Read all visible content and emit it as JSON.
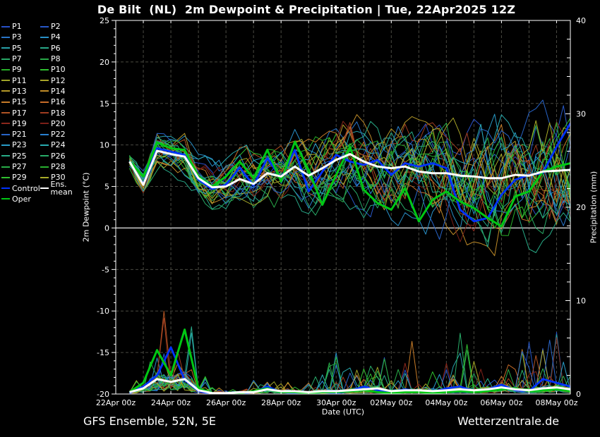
{
  "title": "De Bilt  (NL)  2m Dewpoint & Precipitation | Tue, 22Apr2025 12Z",
  "footer": {
    "left": "GFS Ensemble, 52N, 5E",
    "right": "Wetterzentrale.de"
  },
  "axes": {
    "left": {
      "title": "2m Dewpoint (°C)",
      "min": -20,
      "max": 25,
      "major_step": 5,
      "minor_step": 1,
      "tick_labels": [
        "25",
        "20",
        "15",
        "10",
        "5",
        "0",
        "-5",
        "-10",
        "-15",
        "-20"
      ]
    },
    "right": {
      "title": "Precipitation (mm)",
      "min": 0,
      "max": 40,
      "major_step": 10,
      "minor_step": 2,
      "tick_labels": [
        "40",
        "30",
        "20",
        "10",
        "0"
      ]
    },
    "bottom": {
      "title": "Date (UTC)",
      "hours_total": 396,
      "grid_every_hours": 24,
      "label_every_hours": 48,
      "tick_labels": [
        "22Apr 00z",
        "24Apr 00z",
        "26Apr 00z",
        "28Apr 00z",
        "30Apr 00z",
        "02May 00z",
        "04May 00z",
        "06May 00z",
        "08May 00z"
      ]
    }
  },
  "colors": {
    "background": "#000000",
    "grid": "#4a4a42",
    "axis": "#ffffff",
    "zero_line": "#ffffff"
  },
  "legend": {
    "members": [
      {
        "label": "P1",
        "color": "#2850c8"
      },
      {
        "label": "P2",
        "color": "#2858c8"
      },
      {
        "label": "P3",
        "color": "#2874c8"
      },
      {
        "label": "P4",
        "color": "#2890c8"
      },
      {
        "label": "P5",
        "color": "#28a0a8"
      },
      {
        "label": "P6",
        "color": "#28a888"
      },
      {
        "label": "P7",
        "color": "#28a868"
      },
      {
        "label": "P8",
        "color": "#28a848"
      },
      {
        "label": "P9",
        "color": "#28b028"
      },
      {
        "label": "P10",
        "color": "#30c030"
      },
      {
        "label": "P11",
        "color": "#a0a428"
      },
      {
        "label": "P12",
        "color": "#a8a428"
      },
      {
        "label": "P13",
        "color": "#b49828"
      },
      {
        "label": "P14",
        "color": "#c08c28"
      },
      {
        "label": "P15",
        "color": "#c87c28"
      },
      {
        "label": "P16",
        "color": "#c86c28"
      },
      {
        "label": "P17",
        "color": "#b05424"
      },
      {
        "label": "P18",
        "color": "#a03c20"
      },
      {
        "label": "P19",
        "color": "#8c281c"
      },
      {
        "label": "P20",
        "color": "#7c2018"
      },
      {
        "label": "P21",
        "color": "#2864c8"
      },
      {
        "label": "P22",
        "color": "#2880d0"
      },
      {
        "label": "P23",
        "color": "#289cc8"
      },
      {
        "label": "P24",
        "color": "#28acb0"
      },
      {
        "label": "P25",
        "color": "#28ac88"
      },
      {
        "label": "P26",
        "color": "#28ac68"
      },
      {
        "label": "P27",
        "color": "#28ac48"
      },
      {
        "label": "P28",
        "color": "#28b030"
      },
      {
        "label": "P29",
        "color": "#30c030"
      },
      {
        "label": "P30",
        "color": "#a8ac28"
      }
    ],
    "special": [
      {
        "label": "Control",
        "color": "#0032ff"
      },
      {
        "label": "Ens. mean",
        "color": "#ffffff"
      },
      {
        "label": "Oper",
        "color": "#00c814"
      }
    ]
  },
  "chart_data": {
    "type": "line",
    "title": "De Bilt  (NL)  2m Dewpoint & Precipitation | Tue, 22Apr2025 12Z",
    "xlabel": "Date (UTC)",
    "ylabel_left": "2m Dewpoint (°C)",
    "ylabel_right": "Precipitation (mm)",
    "ylim_left": [
      -20,
      25
    ],
    "ylim_right": [
      0,
      40
    ],
    "x_range_hours": [
      0,
      396
    ],
    "x_start_label": "22Apr 00z",
    "x_end_label": "08May 12z",
    "forecast_hours": {
      "start": 12,
      "end": 396,
      "step": 12
    },
    "grid": "dashed daily vertical, dashed every 5°C horizontal, solid white line at 0°C",
    "series": [
      {
        "name": "Ens. mean",
        "color": "#ffffff",
        "width": 3,
        "dewpoint": [
          8.0,
          5.2,
          9.3,
          8.9,
          8.6,
          6.0,
          4.9,
          5.0,
          5.9,
          5.3,
          6.6,
          6.2,
          7.4,
          6.3,
          7.2,
          8.2,
          8.9,
          8.0,
          7.4,
          7.2,
          7.4,
          6.8,
          6.6,
          6.6,
          6.3,
          6.2,
          6.0,
          6.0,
          6.4,
          6.3,
          6.8,
          6.9,
          7.0
        ],
        "precip": [
          0.2,
          0.6,
          1.6,
          1.3,
          1.6,
          0.4,
          0.1,
          0.1,
          0.2,
          0.2,
          0.5,
          0.3,
          0.3,
          0.2,
          0.3,
          0.3,
          0.4,
          0.5,
          0.6,
          0.3,
          0.4,
          0.4,
          0.3,
          0.4,
          0.5,
          0.4,
          0.5,
          0.7,
          0.5,
          0.4,
          0.6,
          0.7,
          0.5
        ]
      },
      {
        "name": "Control",
        "color": "#0032ff",
        "width": 2.8,
        "dewpoint": [
          8.0,
          5.3,
          9.6,
          9.2,
          8.8,
          5.8,
          4.7,
          5.2,
          7.3,
          5.1,
          8.4,
          6.0,
          9.4,
          4.4,
          6.8,
          8.8,
          8.0,
          7.6,
          8.2,
          6.4,
          7.8,
          7.4,
          7.8,
          7.2,
          2.2,
          0.8,
          1.2,
          4.0,
          5.8,
          6.4,
          6.6,
          9.8,
          12.6
        ],
        "precip": [
          0.1,
          0.8,
          2.0,
          5.0,
          1.5,
          0.3,
          0.0,
          0.0,
          0.1,
          0.2,
          0.8,
          0.2,
          0.1,
          0.0,
          0.2,
          0.1,
          0.3,
          0.8,
          0.4,
          0.2,
          0.5,
          0.3,
          0.2,
          0.6,
          0.8,
          0.3,
          0.5,
          1.0,
          0.4,
          0.3,
          1.6,
          1.2,
          0.8
        ]
      },
      {
        "name": "Oper",
        "color": "#00c814",
        "width": 3,
        "dewpoint": [
          8.0,
          6.2,
          10.3,
          9.6,
          9.4,
          6.2,
          5.0,
          6.2,
          8.0,
          6.0,
          9.4,
          5.6,
          10.4,
          7.0,
          2.8,
          6.4,
          9.8,
          4.6,
          3.0,
          2.2,
          4.8,
          0.8,
          3.4,
          4.4,
          3.2,
          2.4,
          1.2,
          0.2,
          3.8,
          4.4,
          6.8,
          7.4,
          7.8
        ],
        "precip": [
          0.2,
          1.2,
          4.7,
          2.0,
          6.9,
          0.6,
          0.1,
          0.0,
          0.1,
          0.3,
          0.6,
          0.2,
          0.2,
          0.1,
          0.2,
          0.2,
          0.3,
          0.4,
          0.2,
          0.1,
          0.2,
          0.2,
          0.1,
          0.2,
          0.3,
          0.2,
          0.3,
          0.5,
          0.6,
          0.3,
          0.4,
          0.5,
          0.3
        ]
      }
    ],
    "ensemble_envelope": {
      "dewpoint_min": [
        7.2,
        3.0,
        6.5,
        6.0,
        5.5,
        3.0,
        2.0,
        1.5,
        2.0,
        0.5,
        1.5,
        0.5,
        1.5,
        0.0,
        -0.5,
        0.5,
        0.0,
        -1.0,
        -0.5,
        -1.5,
        -1.0,
        -3.0,
        -2.0,
        -3.5,
        -3.0,
        -4.0,
        -4.5,
        -4.0,
        -3.0,
        -3.5,
        -2.5,
        -2.0,
        -1.5
      ],
      "dewpoint_max": [
        8.8,
        7.5,
        12.0,
        11.5,
        11.5,
        9.0,
        8.5,
        9.0,
        10.0,
        10.0,
        11.5,
        11.0,
        12.5,
        11.5,
        12.0,
        13.5,
        15.5,
        13.0,
        14.5,
        15.5,
        14.0,
        13.5,
        13.0,
        13.5,
        14.0,
        13.5,
        14.0,
        15.0,
        14.5,
        15.0,
        15.5,
        15.0,
        14.5
      ],
      "precip_max": [
        0.5,
        3.5,
        8.0,
        10.2,
        9.0,
        5.5,
        0.8,
        0.5,
        0.8,
        1.5,
        3.0,
        1.5,
        2.0,
        1.2,
        2.5,
        4.5,
        3.5,
        3.0,
        4.2,
        4.5,
        8.8,
        3.0,
        2.5,
        4.0,
        9.8,
        4.0,
        3.5,
        4.5,
        6.0,
        5.8,
        5.0,
        7.5,
        4.0
      ]
    },
    "members_note": "30 ensemble members P1-P30 fill the envelope between dewpoint_min/max and up to precip_max"
  }
}
